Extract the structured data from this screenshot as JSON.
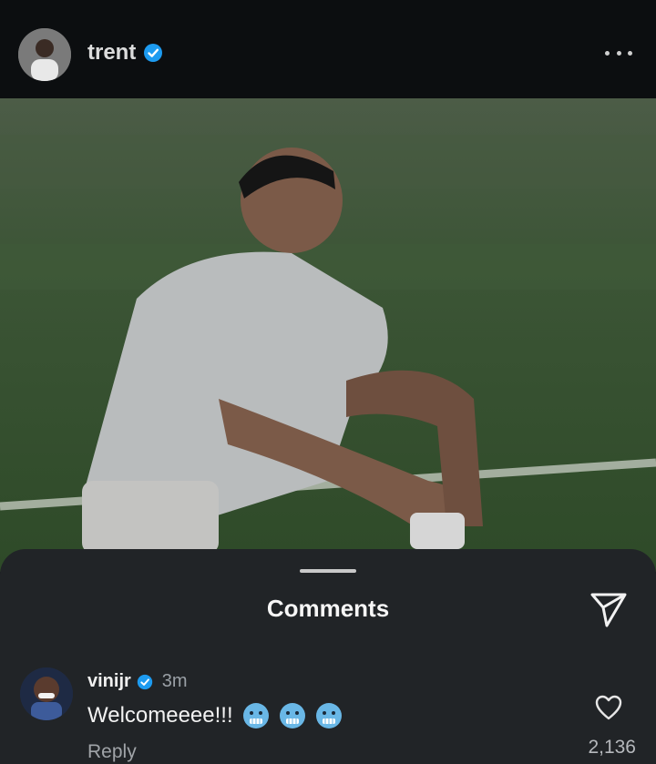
{
  "header": {
    "username": "trent",
    "verified": true,
    "avatar_icon": "profile-avatar",
    "more_icon": "more-dots-icon"
  },
  "post": {
    "image_icon": "post-photo"
  },
  "comments_sheet": {
    "title": "Comments",
    "share_icon": "send-icon"
  },
  "comment": {
    "username": "vinijr",
    "verified": true,
    "time": "3m",
    "text": "Welcomeeee!!!",
    "emojis": [
      "cold-face-emoji",
      "cold-face-emoji",
      "cold-face-emoji"
    ],
    "reply_label": "Reply",
    "like_count": "2,136"
  },
  "colors": {
    "verified_blue": "#1d9bf0",
    "sheet_bg": "#212427"
  }
}
